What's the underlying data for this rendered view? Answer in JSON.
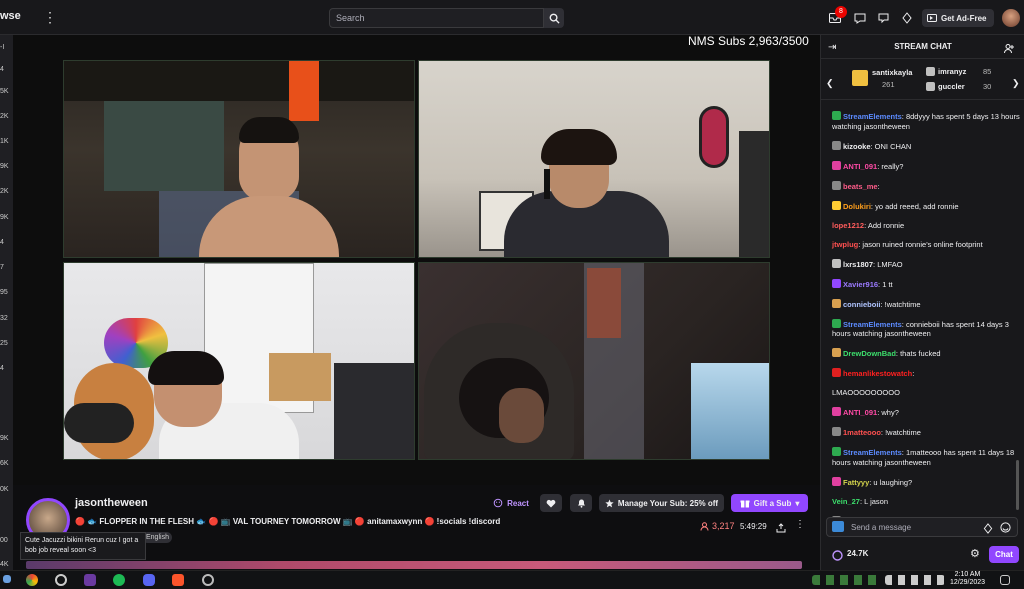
{
  "topbar": {
    "brand_fragment": "wse",
    "search_placeholder": "Search",
    "notification_count": "8",
    "ad_free_label": "Get Ad-Free"
  },
  "left_rail": [
    "-I",
    "4",
    "5K",
    "2K",
    "1K",
    "9K",
    "2K",
    "9K",
    "4",
    "7",
    "95",
    "32",
    "25",
    "4",
    "9K",
    "6K",
    "0K",
    "00",
    "4K"
  ],
  "video": {
    "overlay_text": "NMS Subs 2,963/3500"
  },
  "channel": {
    "name": "jasontheween",
    "title": "🔴 🐟 FLOPPER IN THE FLESH 🐟 🔴 📺 VAL TOURNEY TOMORROW 📺 🔴 anitamaxwynn 🔴 !socials !discord",
    "tag": "English",
    "viewers": "3,217",
    "uptime": "5:49:29",
    "react_label": "React",
    "manage_sub_label": "Manage Your Sub: 25% off",
    "gift_sub_label": "Gift a Sub",
    "tooltip": "Cute Jacuzzi bikini Rerun cuz I got a bob job reveal soon <3"
  },
  "chat": {
    "header": "STREAM CHAT",
    "gifters": [
      {
        "name": "santixkayla",
        "count": "261"
      },
      {
        "name": "imranyz",
        "count": "85"
      },
      {
        "name": "guccler",
        "count": "30"
      }
    ],
    "messages": [
      {
        "user": "StreamElements",
        "color": "#5c8bff",
        "badge": "#2eaa50",
        "text": ": 8ddyyy has spent 5 days 13 hours watching jasontheween"
      },
      {
        "user": "kizooke",
        "color": "#efeff1",
        "badge": "#888888",
        "text": ": ONI CHAN"
      },
      {
        "user": "ANTI_091",
        "color": "#ff4aa6",
        "badge": "#e040a0",
        "text": ": really?"
      },
      {
        "user": "beats_me",
        "color": "#ff5c8a",
        "badge": "#888888",
        "text": ":"
      },
      {
        "user": "Dolukiri",
        "color": "#ff9f1c",
        "badge": "#ffcc33",
        "text": ": yo add reeed, add ronnie"
      },
      {
        "user": "lope1212",
        "color": "#ff5c5c",
        "badge": "",
        "text": ": Add ronnie"
      },
      {
        "user": "jtwplug",
        "color": "#ff5050",
        "badge": "",
        "text": ": jason ruined ronnie's online footprint"
      },
      {
        "user": "lxrs1807",
        "color": "#efeff1",
        "badge": "#c0c0c0",
        "text": ": LMFAO"
      },
      {
        "user": "Xavier916",
        "color": "#9b7bff",
        "badge": "#9147ff",
        "text": ": 1 tt"
      },
      {
        "user": "connieboii",
        "color": "#b0c4ff",
        "badge": "#d8a050",
        "text": ": !watchtime"
      },
      {
        "user": "StreamElements",
        "color": "#5c8bff",
        "badge": "#2eaa50",
        "text": ": connieboii has spent 14 days 3 hours watching jasontheween"
      },
      {
        "user": "DrewDownBad",
        "color": "#3cde6c",
        "badge": "#d8a050",
        "text": ": thats fucked"
      },
      {
        "user": "hemanlikestowatch",
        "color": "#ff2020",
        "badge": "#e02020",
        "text": ":"
      },
      {
        "user": "",
        "color": "#efeff1",
        "badge": "",
        "text": "LMAOOOOOOOOO"
      },
      {
        "user": "ANTI_091",
        "color": "#ff4aa6",
        "badge": "#e040a0",
        "text": ": why?"
      },
      {
        "user": "1matteooo",
        "color": "#ff5050",
        "badge": "#888888",
        "text": ": !watchtime"
      },
      {
        "user": "StreamElements",
        "color": "#5c8bff",
        "badge": "#2eaa50",
        "text": ": 1matteooo has spent 11 days 18 hours watching jasontheween"
      },
      {
        "user": "Fattyyy",
        "color": "#d4d44c",
        "badge": "#e040a0",
        "text": ": u laughing?"
      },
      {
        "user": "Vein_27",
        "color": "#3cde6c",
        "badge": "",
        "text": ": L jason"
      },
      {
        "user": "jriangler",
        "color": "#9b7bff",
        "badge": "#888888",
        "text": ": so we laughging"
      }
    ],
    "input_placeholder": "Send a message",
    "points": "24.7K",
    "send_label": "Chat"
  },
  "taskbar": {
    "time": "2:10 AM",
    "date": "12/29/2023"
  }
}
